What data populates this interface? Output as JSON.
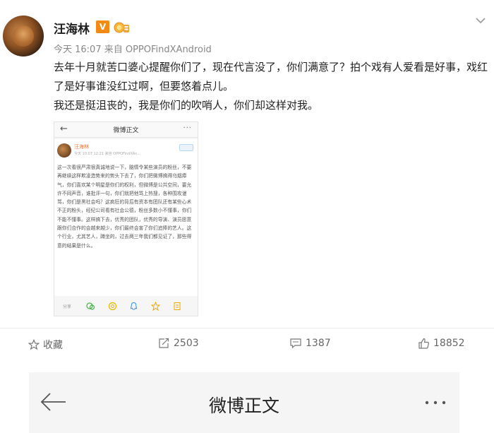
{
  "post": {
    "username": "汪海林",
    "vip_badge": "V",
    "meta": "今天 16:07 来自 OPPOFindXAndroid",
    "text_line1": "去年十月就苦口婆心提醒你们了，现在代言没了，你们满意了？拍个戏有人爱看是好事，戏红了是好事谁没红过啊，但要悠着点儿。",
    "text_line2": "我还是挺沮丧的，我是你们的吹哨人，你们却这样对我。"
  },
  "embedded": {
    "title": "微博正文",
    "name": "汪海林",
    "time": "今天 10:07 12:21 来自 OPPOFindXAn...",
    "body": "这一次看很严肃很真诚地说一下，脑情令某些演员的粉丝，不要再继续这样欺凌造势来的势头下去了，你们把微博搞得乌烟瘴气，你们喜欢某个明星是你们的权利，但微博是公共空间，要允许不同声音，谁批评一句，你们就把他骂上热搜，各种围攻谩骂，你们是黑社会吗？这疯狂的背后有资本有团队还有某些心术不正的粉头，经纪公司看有社会公德，粉丝多数小不懂事，你们不能不懂事。这样搞下去，优秀的团队，优秀的导演、演员愿意跟你们合作的会越来越少，你们最终会害了你们追捧的艺人。这个行业，尤其艺人，蹲坐的，过去两三年我们都见证了，那些得意的结果是什么。",
    "footer_label": "分享"
  },
  "actions": {
    "favorite": "收藏",
    "repost": "2503",
    "comment": "1387",
    "like": "18852"
  },
  "detail": {
    "title": "微博正文"
  },
  "icons": {
    "chevron": "chevron-down-icon",
    "back": "arrow-left-icon",
    "more": "more-icon"
  },
  "colors": {
    "vip": "#f48a13",
    "name_link": "#e8762c"
  }
}
